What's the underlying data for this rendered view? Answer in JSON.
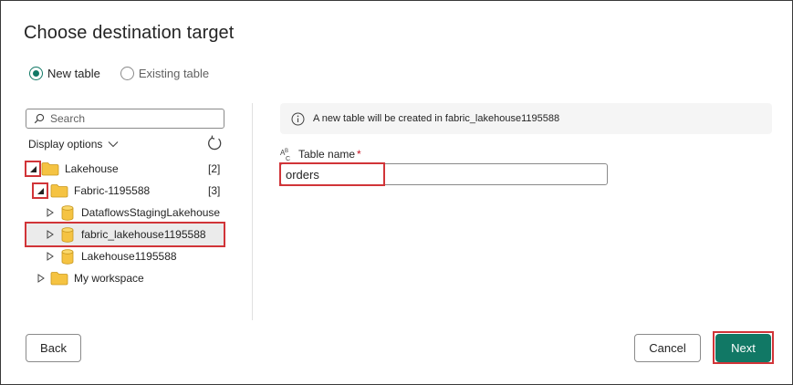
{
  "dialog": {
    "title": "Choose destination target"
  },
  "mode": {
    "options": [
      {
        "label": "New table",
        "checked": true
      },
      {
        "label": "Existing table",
        "checked": false
      }
    ]
  },
  "browser": {
    "search_placeholder": "Search",
    "display_options_label": "Display options",
    "tree": [
      {
        "label": "Lakehouse",
        "count": "[2]",
        "type": "folder",
        "expanded": true,
        "highlighted_expander": true
      },
      {
        "label": "Fabric-1195588",
        "count": "[3]",
        "type": "folder",
        "expanded": true,
        "highlighted_expander": true
      },
      {
        "label": "DataflowsStagingLakehouse",
        "type": "database",
        "expanded": false
      },
      {
        "label": "fabric_lakehouse1195588",
        "type": "database",
        "expanded": false,
        "selected": true
      },
      {
        "label": "Lakehouse1195588",
        "type": "database",
        "expanded": false
      },
      {
        "label": "My workspace",
        "type": "folder",
        "expanded": false
      }
    ]
  },
  "details": {
    "info_message": "A new table will be created in fabric_lakehouse1195588",
    "table_name_label": "Table name",
    "required_marker": "*",
    "table_name_value": "orders"
  },
  "footer": {
    "back_label": "Back",
    "cancel_label": "Cancel",
    "next_label": "Next"
  },
  "colors": {
    "accent": "#117865",
    "highlight_red": "#d13438",
    "folder_yellow": "#f5c342",
    "selected_row": "#ebebeb"
  }
}
